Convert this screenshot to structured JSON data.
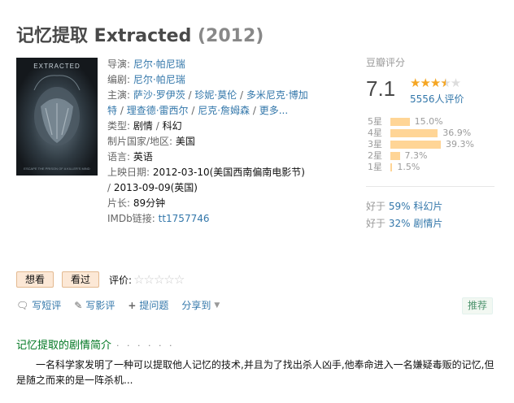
{
  "title": {
    "name": "记忆提取 Extracted",
    "year": "(2012)"
  },
  "poster": {
    "top_text": "EXTRACTED",
    "bottom_text": "ESCAPE THE PRISON OF A KILLER'S MIND"
  },
  "info": {
    "director_label": "导演:",
    "director": "尼尔·帕尼瑞",
    "writer_label": "编剧:",
    "writer": "尼尔·帕尼瑞",
    "cast_label": "主演:",
    "cast": [
      "萨沙·罗伊茨",
      "珍妮·莫伦",
      "多米尼克·博加特",
      "理查德·雷西尔",
      "尼克·詹姆森"
    ],
    "cast_more": "更多...",
    "genre_label": "类型:",
    "genres": [
      "剧情",
      "科幻"
    ],
    "country_label": "制片国家/地区:",
    "country": "美国",
    "language_label": "语言:",
    "language": "英语",
    "release_label": "上映日期:",
    "release_1": "2012-03-10(美国西南偏南电影节)",
    "release_2": "2013-09-09(英国)",
    "runtime_label": "片长:",
    "runtime": "89分钟",
    "imdb_label": "IMDb链接:",
    "imdb": "tt1757746"
  },
  "rating": {
    "label": "豆瓣评分",
    "score": "7.1",
    "stars": 3.5,
    "count_text": "5556人评价",
    "breakdown": [
      {
        "label": "5星",
        "percent": 15.0,
        "text": "15.0%"
      },
      {
        "label": "4星",
        "percent": 36.9,
        "text": "36.9%"
      },
      {
        "label": "3星",
        "percent": 39.3,
        "text": "39.3%"
      },
      {
        "label": "2星",
        "percent": 7.3,
        "text": "7.3%"
      },
      {
        "label": "1星",
        "percent": 1.5,
        "text": "1.5%"
      }
    ],
    "better_1_prefix": "好于 ",
    "better_1_link": "59% 科幻片",
    "better_2_prefix": "好于 ",
    "better_2_link": "32% 剧情片"
  },
  "buttons": {
    "want": "想看",
    "seen": "看过",
    "rate_label": "评价:"
  },
  "actions": {
    "short_review": "写短评",
    "review": "写影评",
    "question": "提问题",
    "share": "分享到",
    "recommend": "推荐"
  },
  "synopsis": {
    "title": "记忆提取的剧情简介",
    "dots": "· · · · · ·",
    "text": "一名科学家发明了一种可以提取他人记忆的技术,并且为了找出杀人凶手,他奉命进入一名嫌疑毒贩的记忆,但是随之而来的是一阵杀机..."
  },
  "colors": {
    "link": "#3377aa",
    "star": "#f5a623",
    "bar": "#ffd596",
    "green": "#007722"
  }
}
